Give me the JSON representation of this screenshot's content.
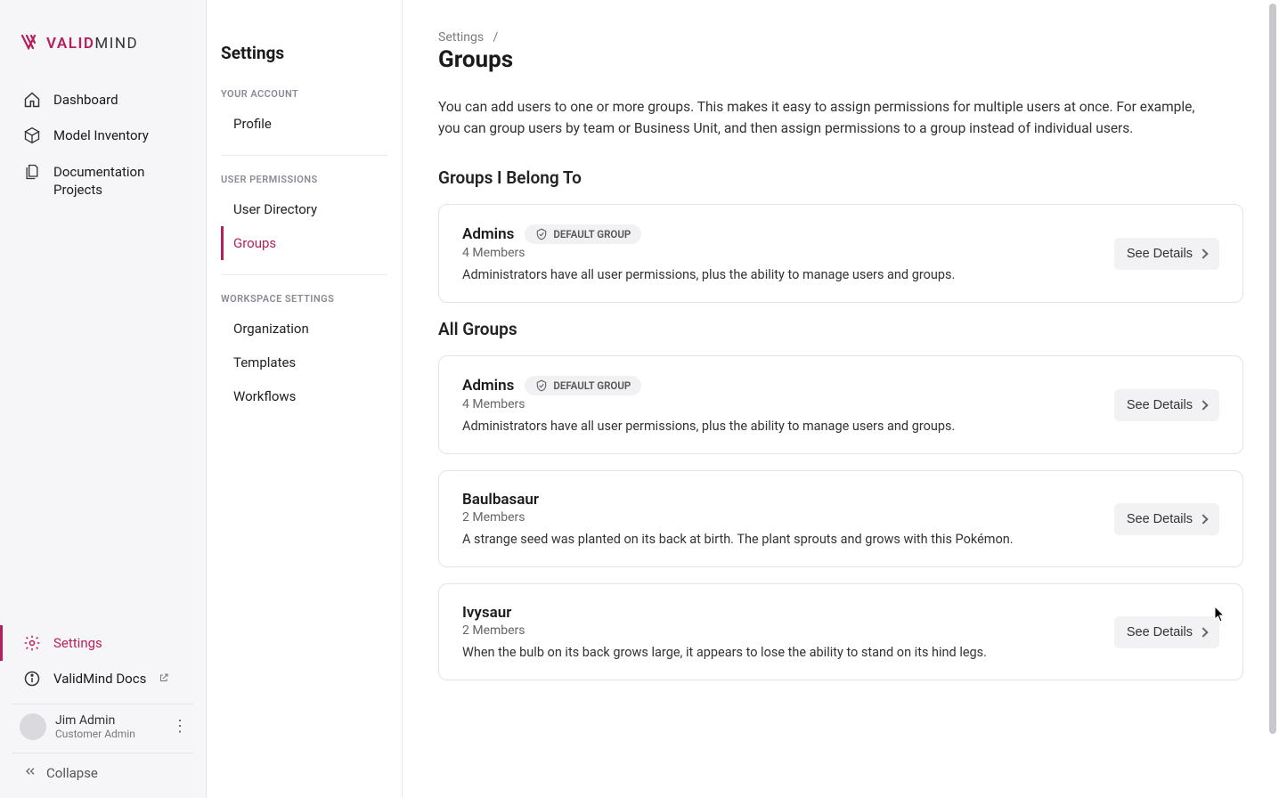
{
  "brand": {
    "name": "ValidMind"
  },
  "primaryNav": {
    "dashboard": "Dashboard",
    "model_inventory": "Model Inventory",
    "doc_projects": "Documentation Projects",
    "settings": "Settings",
    "docs": "ValidMind Docs"
  },
  "user": {
    "name": "Jim Admin",
    "role": "Customer Admin"
  },
  "collapse_label": "Collapse",
  "settingsPanel": {
    "title": "Settings",
    "sections": {
      "account": {
        "label": "YOUR ACCOUNT",
        "profile": "Profile"
      },
      "permissions": {
        "label": "USER PERMISSIONS",
        "directory": "User Directory",
        "groups": "Groups"
      },
      "workspace": {
        "label": "WORKSPACE SETTINGS",
        "organization": "Organization",
        "templates": "Templates",
        "workflows": "Workflows"
      }
    }
  },
  "main": {
    "breadcrumb_parent": "Settings",
    "breadcrumb_sep": "/",
    "title": "Groups",
    "intro": "You can add users to one or more groups. This makes it easy to assign permissions for multiple users at once. For example, you can group users by team or Business Unit, and then assign permissions to a group instead of individual users.",
    "section1_title": "Groups I Belong To",
    "section2_title": "All Groups",
    "details_label": "See Details",
    "default_badge": "DEFAULT GROUP",
    "myGroups": [
      {
        "name": "Admins",
        "members": "4 Members",
        "desc": "Administrators have all user permissions, plus the ability to manage users and groups.",
        "default": true
      }
    ],
    "allGroups": [
      {
        "name": "Admins",
        "members": "4 Members",
        "desc": "Administrators have all user permissions, plus the ability to manage users and groups.",
        "default": true
      },
      {
        "name": "Baulbasaur",
        "members": "2 Members",
        "desc": "A strange seed was planted on its back at birth. The plant sprouts and grows with this Pokémon.",
        "default": false
      },
      {
        "name": "Ivysaur",
        "members": "2 Members",
        "desc": "When the bulb on its back grows large, it appears to lose the ability to stand on its hind legs.",
        "default": false
      }
    ]
  }
}
